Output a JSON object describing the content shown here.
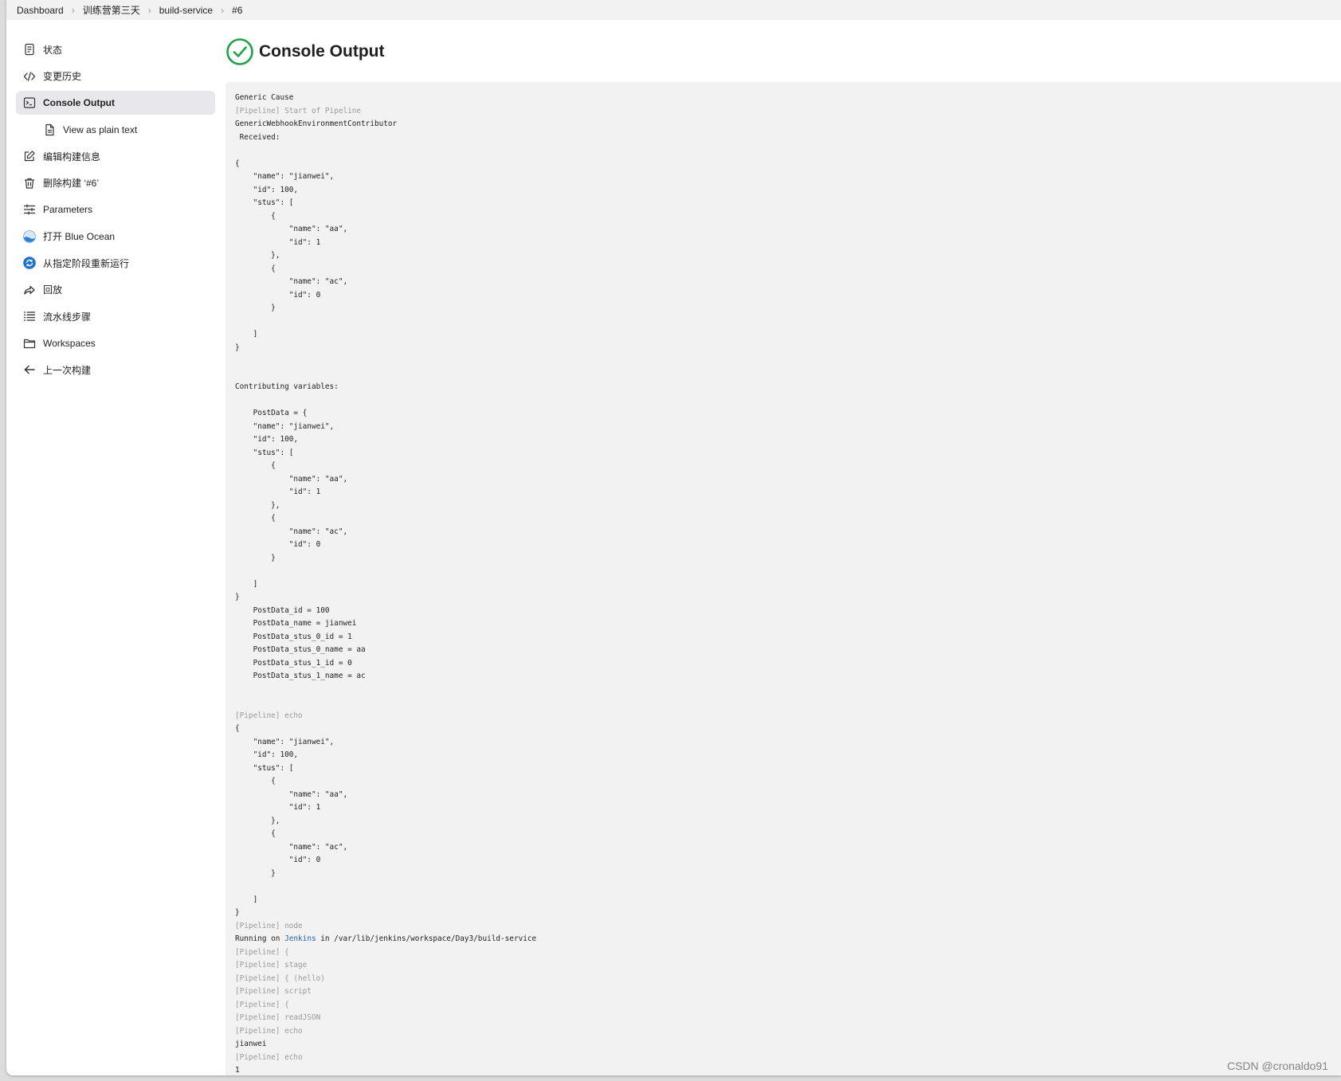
{
  "breadcrumb": [
    "Dashboard",
    "训练营第三天",
    "build-service",
    "#6"
  ],
  "sidebar": {
    "items": [
      {
        "label": "状态",
        "icon": "document-icon"
      },
      {
        "label": "变更历史",
        "icon": "code-icon"
      },
      {
        "label": "Console Output",
        "icon": "terminal-icon",
        "active": true
      },
      {
        "label": "View as plain text",
        "icon": "file-text-icon",
        "sub": true
      },
      {
        "label": "编辑构建信息",
        "icon": "edit-icon"
      },
      {
        "label": "删除构建 ‘#6’",
        "icon": "trash-icon"
      },
      {
        "label": "Parameters",
        "icon": "sliders-icon"
      },
      {
        "label": "打开 Blue Ocean",
        "icon": "blue-ocean-icon"
      },
      {
        "label": "从指定阶段重新运行",
        "icon": "restart-icon"
      },
      {
        "label": "回放",
        "icon": "replay-icon"
      },
      {
        "label": "流水线步骤",
        "icon": "list-icon"
      },
      {
        "label": "Workspaces",
        "icon": "folder-icon"
      },
      {
        "label": "上一次构建",
        "icon": "arrow-left-icon"
      }
    ]
  },
  "header": {
    "title": "Console Output",
    "status_icon": "success-check-icon",
    "status_color": "#1ea446"
  },
  "console": {
    "lines": [
      {
        "text": "Generic Cause"
      },
      {
        "text": "[Pipeline] Start of Pipeline",
        "pipeline": true
      },
      {
        "text": "GenericWebhookEnvironmentContributor"
      },
      {
        "text": " Received:"
      },
      {
        "text": ""
      },
      {
        "text": "{"
      },
      {
        "text": "    \"name\": \"jianwei\","
      },
      {
        "text": "    \"id\": 100,"
      },
      {
        "text": "    \"stus\": ["
      },
      {
        "text": "        {"
      },
      {
        "text": "            \"name\": \"aa\","
      },
      {
        "text": "            \"id\": 1"
      },
      {
        "text": "        },"
      },
      {
        "text": "        {"
      },
      {
        "text": "            \"name\": \"ac\","
      },
      {
        "text": "            \"id\": 0"
      },
      {
        "text": "        }"
      },
      {
        "text": ""
      },
      {
        "text": "    ]"
      },
      {
        "text": "}"
      },
      {
        "text": ""
      },
      {
        "text": ""
      },
      {
        "text": "Contributing variables:"
      },
      {
        "text": ""
      },
      {
        "text": "    PostData = {"
      },
      {
        "text": "    \"name\": \"jianwei\","
      },
      {
        "text": "    \"id\": 100,"
      },
      {
        "text": "    \"stus\": ["
      },
      {
        "text": "        {"
      },
      {
        "text": "            \"name\": \"aa\","
      },
      {
        "text": "            \"id\": 1"
      },
      {
        "text": "        },"
      },
      {
        "text": "        {"
      },
      {
        "text": "            \"name\": \"ac\","
      },
      {
        "text": "            \"id\": 0"
      },
      {
        "text": "        }"
      },
      {
        "text": ""
      },
      {
        "text": "    ]"
      },
      {
        "text": "}"
      },
      {
        "text": "    PostData_id = 100"
      },
      {
        "text": "    PostData_name = jianwei"
      },
      {
        "text": "    PostData_stus_0_id = 1"
      },
      {
        "text": "    PostData_stus_0_name = aa"
      },
      {
        "text": "    PostData_stus_1_id = 0"
      },
      {
        "text": "    PostData_stus_1_name = ac"
      },
      {
        "text": ""
      },
      {
        "text": ""
      },
      {
        "text": "[Pipeline] echo",
        "pipeline": true
      },
      {
        "text": "{"
      },
      {
        "text": "    \"name\": \"jianwei\","
      },
      {
        "text": "    \"id\": 100,"
      },
      {
        "text": "    \"stus\": ["
      },
      {
        "text": "        {"
      },
      {
        "text": "            \"name\": \"aa\","
      },
      {
        "text": "            \"id\": 1"
      },
      {
        "text": "        },"
      },
      {
        "text": "        {"
      },
      {
        "text": "            \"name\": \"ac\","
      },
      {
        "text": "            \"id\": 0"
      },
      {
        "text": "        }"
      },
      {
        "text": ""
      },
      {
        "text": "    ]"
      },
      {
        "text": "}"
      },
      {
        "text": "[Pipeline] node",
        "pipeline": true
      },
      {
        "text": "Running on ",
        "link": "Jenkins",
        "after": " in /var/lib/jenkins/workspace/Day3/build-service"
      },
      {
        "text": "[Pipeline] {",
        "pipeline": true
      },
      {
        "text": "[Pipeline] stage",
        "pipeline": true
      },
      {
        "text": "[Pipeline] { (hello)",
        "pipeline": true
      },
      {
        "text": "[Pipeline] script",
        "pipeline": true
      },
      {
        "text": "[Pipeline] {",
        "pipeline": true
      },
      {
        "text": "[Pipeline] readJSON",
        "pipeline": true
      },
      {
        "text": "[Pipeline] echo",
        "pipeline": true
      },
      {
        "text": "jianwei"
      },
      {
        "text": "[Pipeline] echo",
        "pipeline": true
      },
      {
        "text": "1"
      }
    ]
  },
  "watermark": "CSDN @cronaldo91"
}
